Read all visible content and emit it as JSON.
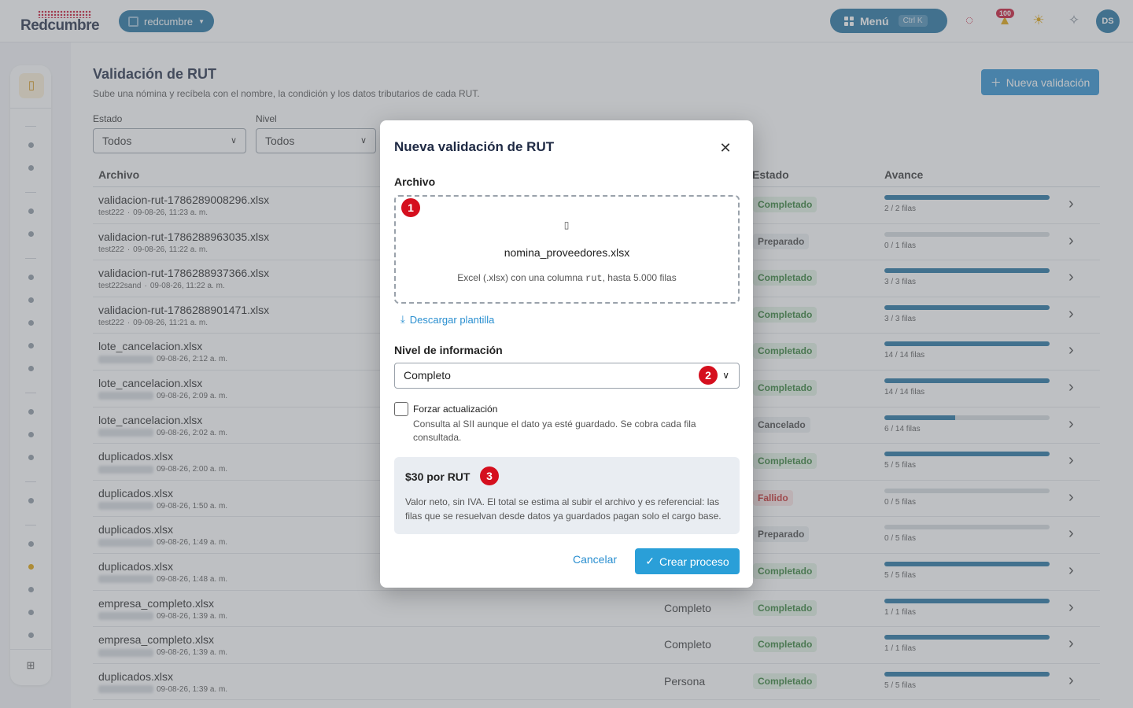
{
  "topbar": {
    "logo": "Redcumbre",
    "workspace": "redcumbre",
    "menu_label": "Menú",
    "menu_shortcut": "Ctrl K",
    "notifications_count": "100",
    "avatar_initials": "DS"
  },
  "page": {
    "title": "Validación de RUT",
    "subtitle": "Sube una nómina y recíbela con el nombre, la condición y los datos tributarios de cada RUT.",
    "new_button": "Nueva validación"
  },
  "filters": {
    "estado_label": "Estado",
    "estado_value": "Todos",
    "nivel_label": "Nivel",
    "nivel_value": "Todos"
  },
  "table": {
    "headers": {
      "archivo": "Archivo",
      "estado": "Estado",
      "avance": "Avance"
    },
    "rows": [
      {
        "file": "validacion-rut-1786289008296.xlsx",
        "user": "test222",
        "date": "09-08-26, 11:23 a. m.",
        "level": "",
        "status": "Completado",
        "status_kind": "ok",
        "progress": "2 / 2 filas",
        "fill": 1.0
      },
      {
        "file": "validacion-rut-1786288963035.xlsx",
        "user": "test222",
        "date": "09-08-26, 11:22 a. m.",
        "level": "",
        "status": "Preparado",
        "status_kind": "prep",
        "progress": "0 / 1 filas",
        "fill": 0.0
      },
      {
        "file": "validacion-rut-1786288937366.xlsx",
        "user": "test222sand",
        "date": "09-08-26, 11:22 a. m.",
        "level": "",
        "status": "Completado",
        "status_kind": "ok",
        "progress": "3 / 3 filas",
        "fill": 1.0
      },
      {
        "file": "validacion-rut-1786288901471.xlsx",
        "user": "test222",
        "date": "09-08-26, 11:21 a. m.",
        "level": "",
        "status": "Completado",
        "status_kind": "ok",
        "progress": "3 / 3 filas",
        "fill": 1.0
      },
      {
        "file": "lote_cancelacion.xlsx",
        "user": "",
        "date": "09-08-26, 2:12 a. m.",
        "level": "",
        "status": "Completado",
        "status_kind": "ok",
        "progress": "14 / 14 filas",
        "fill": 1.0
      },
      {
        "file": "lote_cancelacion.xlsx",
        "user": "",
        "date": "09-08-26, 2:09 a. m.",
        "level": "",
        "status": "Completado",
        "status_kind": "ok",
        "progress": "14 / 14 filas",
        "fill": 1.0
      },
      {
        "file": "lote_cancelacion.xlsx",
        "user": "",
        "date": "09-08-26, 2:02 a. m.",
        "level": "",
        "status": "Cancelado",
        "status_kind": "can",
        "progress": "6 / 14 filas",
        "fill": 0.43
      },
      {
        "file": "duplicados.xlsx",
        "user": "",
        "date": "09-08-26, 2:00 a. m.",
        "level": "",
        "status": "Completado",
        "status_kind": "ok",
        "progress": "5 / 5 filas",
        "fill": 1.0
      },
      {
        "file": "duplicados.xlsx",
        "user": "",
        "date": "09-08-26, 1:50 a. m.",
        "level": "",
        "status": "Fallido",
        "status_kind": "fail",
        "progress": "0 / 5 filas",
        "fill": 0.0
      },
      {
        "file": "duplicados.xlsx",
        "user": "",
        "date": "09-08-26, 1:49 a. m.",
        "level": "",
        "status": "Preparado",
        "status_kind": "prep",
        "progress": "0 / 5 filas",
        "fill": 0.0
      },
      {
        "file": "duplicados.xlsx",
        "user": "",
        "date": "09-08-26, 1:48 a. m.",
        "level": "",
        "status": "Completado",
        "status_kind": "ok",
        "progress": "5 / 5 filas",
        "fill": 1.0
      },
      {
        "file": "empresa_completo.xlsx",
        "user": "",
        "date": "09-08-26, 1:39 a. m.",
        "level": "Completo",
        "status": "Completado",
        "status_kind": "ok",
        "progress": "1 / 1 filas",
        "fill": 1.0
      },
      {
        "file": "empresa_completo.xlsx",
        "user": "",
        "date": "09-08-26, 1:39 a. m.",
        "level": "Completo",
        "status": "Completado",
        "status_kind": "ok",
        "progress": "1 / 1 filas",
        "fill": 1.0
      },
      {
        "file": "duplicados.xlsx",
        "user": "",
        "date": "09-08-26, 1:39 a. m.",
        "level": "Persona",
        "status": "Completado",
        "status_kind": "ok",
        "progress": "5 / 5 filas",
        "fill": 1.0
      }
    ]
  },
  "modal": {
    "title": "Nueva validación de RUT",
    "archivo_label": "Archivo",
    "file_name": "nomina_proveedores.xlsx",
    "hint_before": "Excel (.xlsx) con una columna ",
    "hint_code": "rut",
    "hint_after": ", hasta 5.000 filas",
    "download_link": "Descargar plantilla",
    "nivel_label": "Nivel de información",
    "nivel_value": "Completo",
    "force_label": "Forzar actualización",
    "force_desc": "Consulta al SII aunque el dato ya esté guardado. Se cobra cada fila consultada.",
    "price_title": "$30 por RUT",
    "price_desc": "Valor neto, sin IVA. El total se estima al subir el archivo y es referencial: las filas que se resuelvan desde datos ya guardados pagan solo el cargo base.",
    "cancel_label": "Cancelar",
    "create_label": "Crear proceso",
    "markers": [
      "1",
      "2",
      "3"
    ]
  }
}
